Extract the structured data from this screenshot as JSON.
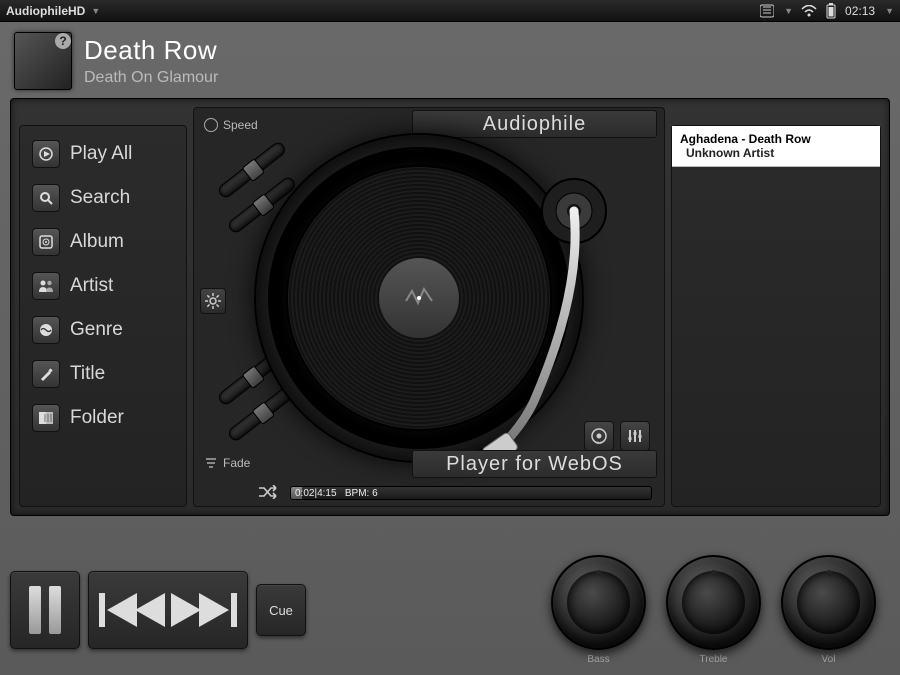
{
  "statusbar": {
    "app": "AudiophileHD",
    "clock": "02:13"
  },
  "now_playing": {
    "title": "Death Row",
    "artist": "Death On Glamour"
  },
  "sidebar": {
    "items": [
      {
        "label": "Play All"
      },
      {
        "label": "Search"
      },
      {
        "label": "Album"
      },
      {
        "label": "Artist"
      },
      {
        "label": "Genre"
      },
      {
        "label": "Title"
      },
      {
        "label": "Folder"
      }
    ]
  },
  "brand": {
    "top": "Audiophile",
    "bottom": "Player for WebOS"
  },
  "sliders": {
    "speed_label": "Speed",
    "fade_label": "Fade"
  },
  "progress": {
    "elapsed": "0:02",
    "total": "4:15",
    "bpm_label": "BPM:",
    "bpm": "6"
  },
  "playlist": {
    "items": [
      {
        "display": "Aghadena - Death Row",
        "artist": "Unknown Artist"
      }
    ]
  },
  "controls": {
    "cue": "Cue"
  },
  "knobs": {
    "bass": "Bass",
    "treble": "Treble",
    "vol": "Vol"
  }
}
